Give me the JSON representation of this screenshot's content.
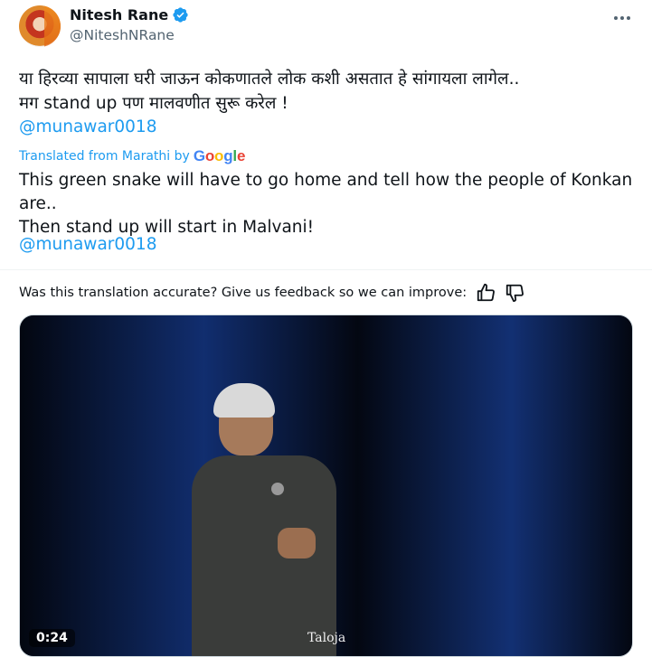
{
  "author": {
    "display_name": "Nitesh Rane",
    "handle": "@NiteshNRane",
    "verified": true
  },
  "tweet": {
    "original_line1": "या हिरव्या सापाला घरी जाऊन कोकणातले लोक कशी असतात हे सांगायला लागेल..",
    "original_line2": "मग stand up पण मालवणीत सुरू करेल !",
    "mention": "@munawar0018"
  },
  "translation": {
    "label": "Translated from Marathi by",
    "google_g1": "G",
    "google_o1": "o",
    "google_o2": "o",
    "google_g2": "g",
    "google_l": "l",
    "google_e": "e",
    "text_line1": "This green snake will have to go home and tell how the people of Konkan are..",
    "text_line2": "Then stand up will start in Malvani!",
    "mention": "@munawar0018"
  },
  "feedback": {
    "question": "Was this translation accurate? Give us feedback so we can improve:"
  },
  "video": {
    "duration": "0:24",
    "caption": "Taloja"
  },
  "icons": {
    "verified": "verified-badge-icon",
    "more": "more-icon",
    "thumbs_up": "thumbs-up-icon",
    "thumbs_down": "thumbs-down-icon"
  },
  "colors": {
    "accent": "#1d9bf0",
    "text": "#0f1419",
    "muted": "#536471"
  }
}
